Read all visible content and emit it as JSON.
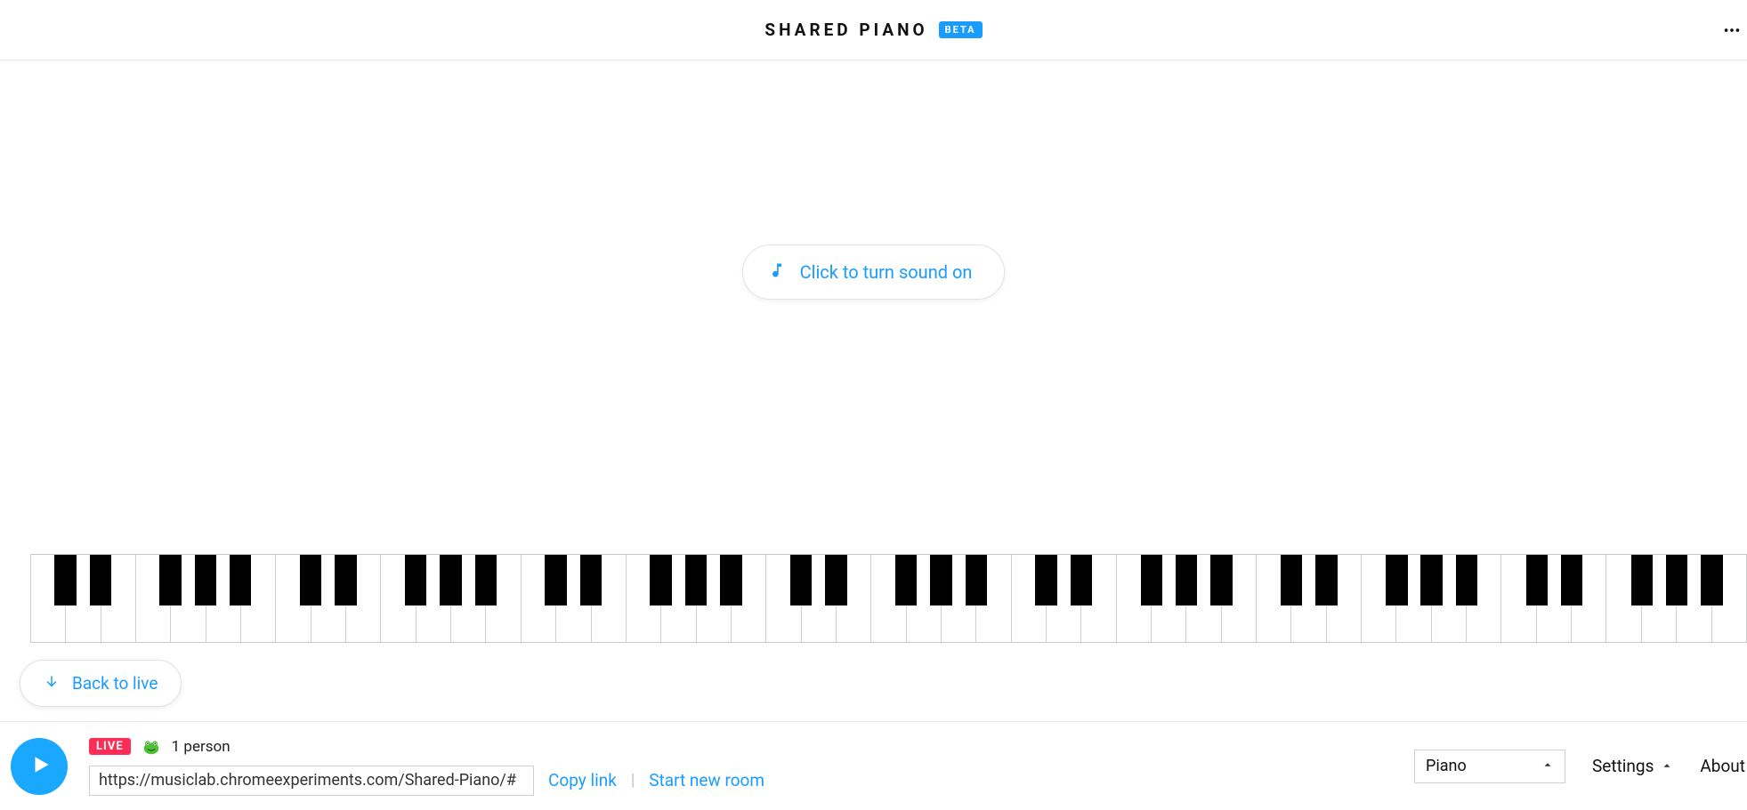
{
  "header": {
    "title": "SHARED PIANO",
    "badge": "BETA"
  },
  "main": {
    "sound_button_label": "Click to turn sound on",
    "back_to_live_label": "Back to live"
  },
  "keyboard": {
    "white_key_count": 49,
    "black_pattern": [
      1,
      1,
      0,
      1,
      1,
      1,
      0
    ]
  },
  "footer": {
    "live_badge": "LIVE",
    "avatar_name": "frog",
    "person_count_label": "1 person",
    "room_url": "https://musiclab.chromeexperiments.com/Shared-Piano/#",
    "copy_link_label": "Copy link",
    "divider": "|",
    "new_room_label": "Start new room",
    "instrument_selected": "Piano",
    "settings_label": "Settings",
    "about_label": "About"
  }
}
